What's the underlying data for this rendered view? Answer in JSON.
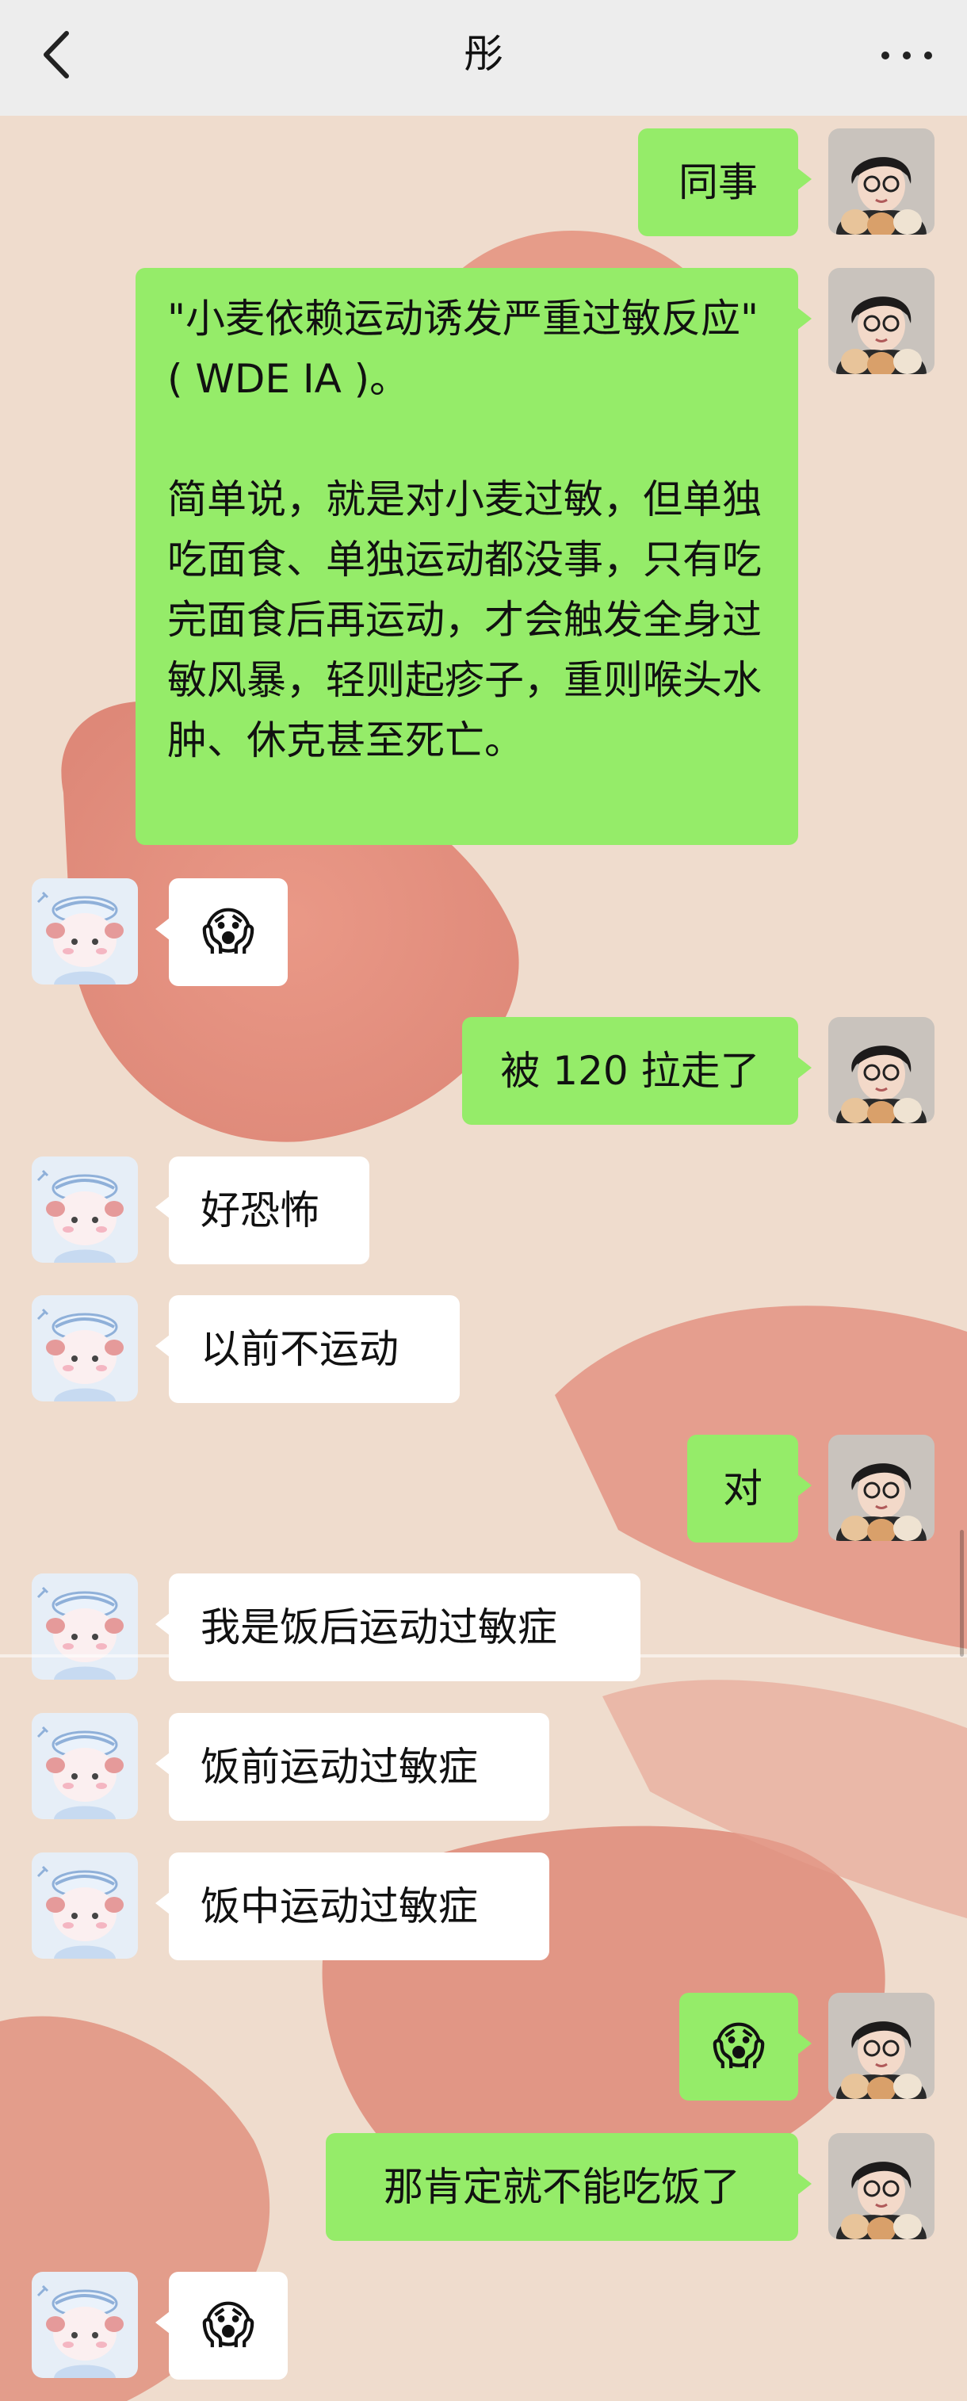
{
  "header": {
    "title": "彤",
    "back_icon": "chevron-left-icon",
    "more_icon": "more-dots-icon"
  },
  "messages": [
    {
      "from": "me",
      "text": "同事"
    },
    {
      "from": "me",
      "text": "\"小麦依赖运动诱发严重过敏反应\"( WDE IA )。\n\n简单说，就是对小麦过敏，但单独吃面食、单独运动都没事，只有吃完面食后再运动，才会触发全身过敏风暴，轻则起疹子，重则喉头水肿、休克甚至死亡。"
    },
    {
      "from": "friend",
      "text": "😱"
    },
    {
      "from": "me",
      "text": "被 120 拉走了"
    },
    {
      "from": "friend",
      "text": "好恐怖"
    },
    {
      "from": "friend",
      "text": "以前不运动"
    },
    {
      "from": "me",
      "text": "对"
    },
    {
      "from": "friend",
      "text": "我是饭后运动过敏症"
    },
    {
      "from": "friend",
      "text": "饭前运动过敏症"
    },
    {
      "from": "friend",
      "text": "饭中运动过敏症"
    },
    {
      "from": "me",
      "text": "😱"
    },
    {
      "from": "me",
      "text": "那肯定就不能吃饭了"
    },
    {
      "from": "friend",
      "text": "😱"
    }
  ],
  "avatars": {
    "me": {
      "icon": "woman-with-glasses-and-cats-avatar"
    },
    "friend": {
      "icon": "cartoon-sailor-creature-avatar"
    }
  },
  "colors": {
    "me_bubble": "#95ec69",
    "friend_bubble": "#ffffff",
    "header": "#ededed"
  }
}
